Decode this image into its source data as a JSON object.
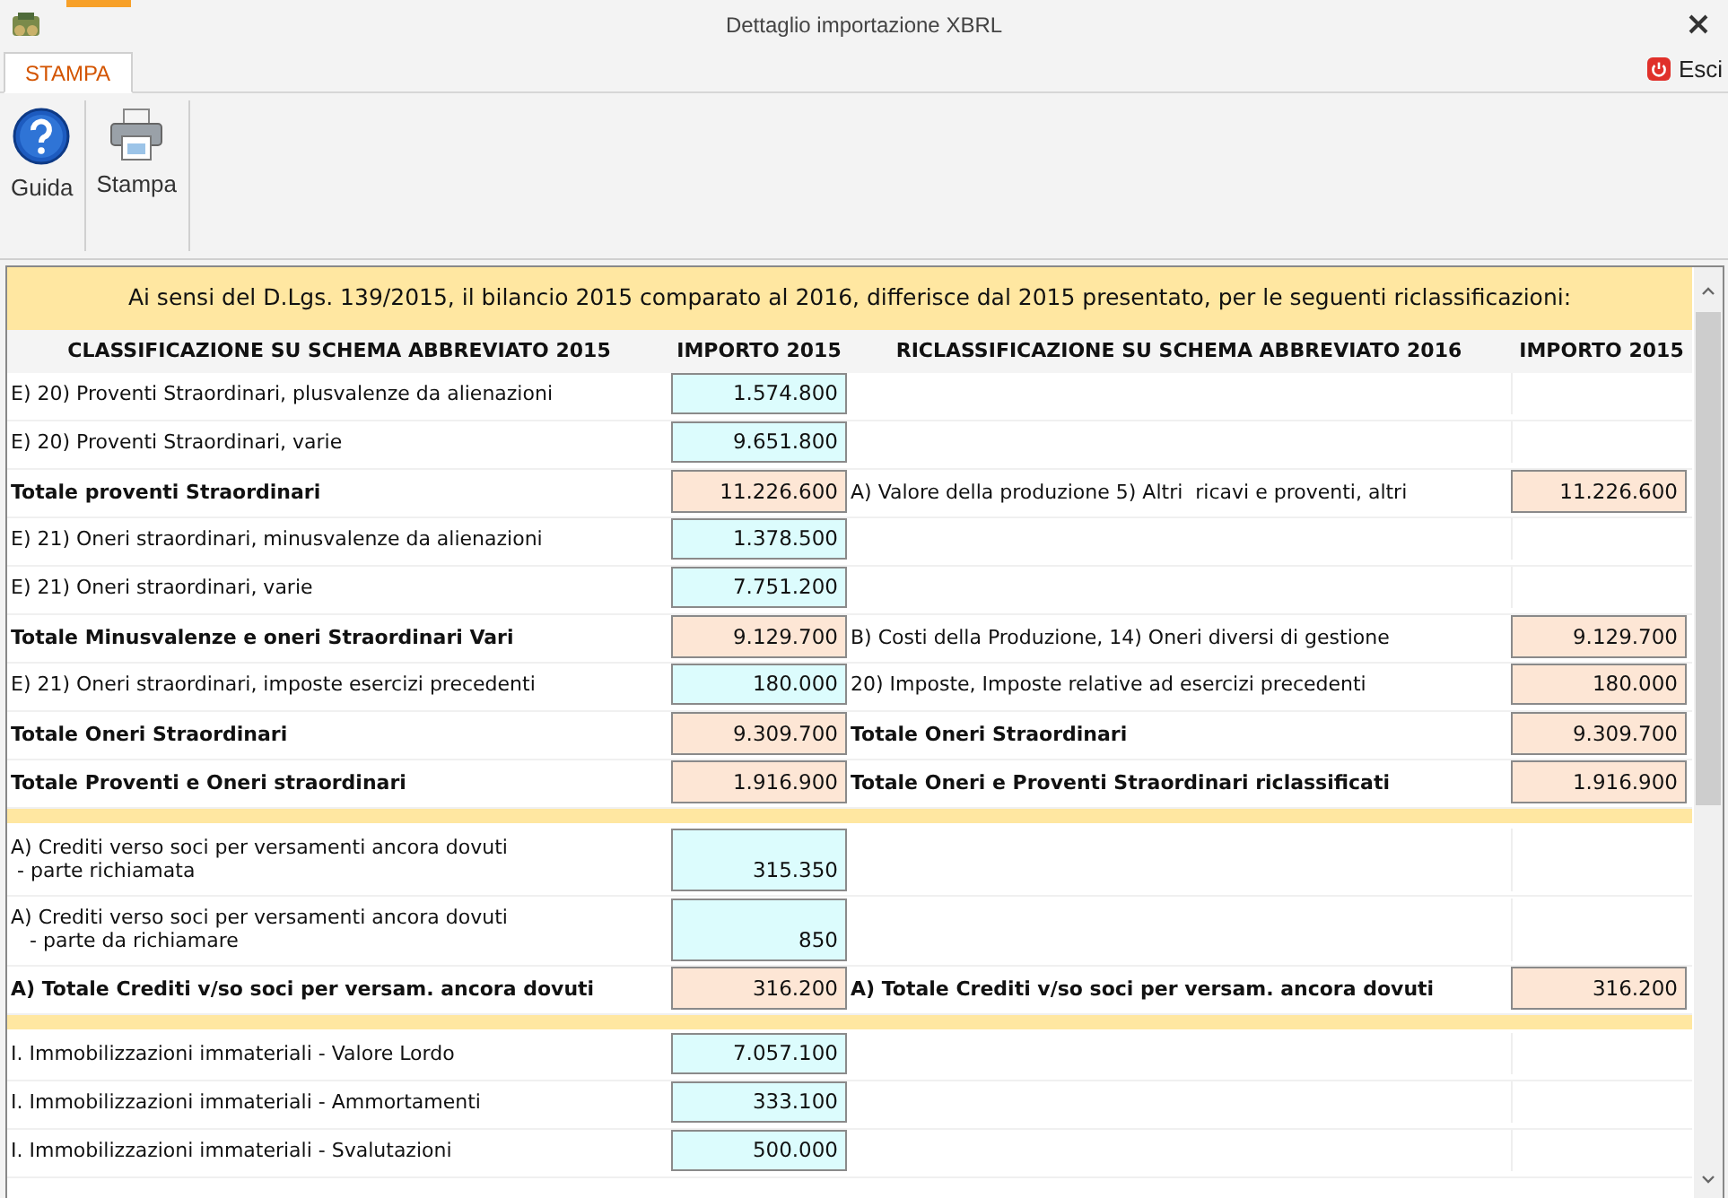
{
  "window": {
    "title": "Dettaglio importazione XBRL"
  },
  "tabs": [
    {
      "label": "STAMPA",
      "selected": true
    }
  ],
  "exit_button": "Esci",
  "ribbon": [
    {
      "kind": "help",
      "label": "Guida"
    },
    {
      "kind": "print",
      "label": "Stampa"
    }
  ],
  "banner": "Ai sensi del D.Lgs. 139/2015, il bilancio 2015 comparato al 2016, differisce dal 2015 presentato, per le seguenti riclassificazioni:",
  "columns": [
    "CLASSIFICAZIONE SU SCHEMA ABBREVIATO 2015",
    "IMPORTO 2015",
    "RICLASSIFICAZIONE SU SCHEMA ABBREVIATO 2016",
    "IMPORTO 2015"
  ],
  "rows": [
    {
      "kind": "item",
      "left": {
        "label": "E) 20) Proventi Straordinari, plusvalenze da alienazioni",
        "value": "1.574.800"
      }
    },
    {
      "kind": "item",
      "left": {
        "label": "E) 20) Proventi Straordinari, varie",
        "value": "9.651.800"
      }
    },
    {
      "kind": "total",
      "left": {
        "label": "Totale proventi Straordinari",
        "value": "11.226.600"
      },
      "right": {
        "kind": "item",
        "label": "A) Valore della produzione 5) Altri  ricavi e proventi, altri",
        "value": "11.226.600"
      }
    },
    {
      "kind": "item",
      "left": {
        "label": "E) 21) Oneri straordinari, minusvalenze da alienazioni",
        "value": "1.378.500"
      }
    },
    {
      "kind": "item",
      "left": {
        "label": "E) 21) Oneri straordinari, varie",
        "value": "7.751.200"
      }
    },
    {
      "kind": "total",
      "left": {
        "label": "Totale Minusvalenze e oneri Straordinari Vari",
        "value": "9.129.700"
      },
      "right": {
        "kind": "item",
        "label": "B) Costi della Produzione, 14) Oneri diversi di gestione",
        "value": "9.129.700"
      }
    },
    {
      "kind": "item",
      "left": {
        "label": "E) 21) Oneri straordinari, imposte esercizi precedenti",
        "value": "180.000"
      },
      "right": {
        "kind": "item",
        "label": "20) Imposte, Imposte relative ad esercizi precedenti",
        "value": "180.000"
      }
    },
    {
      "kind": "total",
      "left": {
        "label": "Totale Oneri Straordinari",
        "value": "9.309.700"
      },
      "right": {
        "kind": "total",
        "label": "Totale Oneri Straordinari",
        "value": "9.309.700"
      }
    },
    {
      "kind": "total",
      "left": {
        "label": "Totale Proventi e Oneri straordinari",
        "value": "1.916.900"
      },
      "right": {
        "kind": "total",
        "label": "Totale Oneri e Proventi Straordinari riclassificati",
        "value": "1.916.900"
      }
    },
    {
      "kind": "separator"
    },
    {
      "kind": "item",
      "left": {
        "label": "A) Crediti verso soci per versamenti ancora dovuti\n - parte richiamata",
        "value": "315.350"
      }
    },
    {
      "kind": "item",
      "left": {
        "label": "A) Crediti verso soci per versamenti ancora dovuti\n   - parte da richiamare",
        "value": "850"
      }
    },
    {
      "kind": "total",
      "left": {
        "label": "A) Totale Crediti v/so soci per versam. ancora dovuti",
        "value": "316.200"
      },
      "right": {
        "kind": "total",
        "label": "A) Totale Crediti v/so soci per versam. ancora dovuti",
        "value": "316.200"
      }
    },
    {
      "kind": "separator"
    },
    {
      "kind": "item",
      "left": {
        "label": "I. Immobilizzazioni immateriali - Valore Lordo",
        "value": "7.057.100"
      }
    },
    {
      "kind": "item",
      "left": {
        "label": "I. Immobilizzazioni immateriali - Ammortamenti",
        "value": "333.100"
      }
    },
    {
      "kind": "item",
      "left": {
        "label": "I. Immobilizzazioni immateriali - Svalutazioni",
        "value": "500.000"
      }
    }
  ]
}
